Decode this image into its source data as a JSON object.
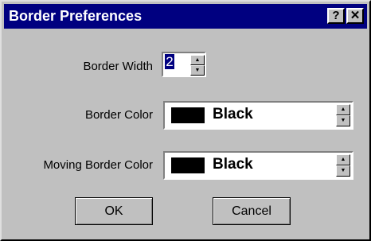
{
  "window": {
    "title": "Border Preferences",
    "help_label": "?",
    "close_label": "✕"
  },
  "fields": {
    "border_width": {
      "label": "Border Width",
      "value": "2"
    },
    "border_color": {
      "label": "Border Color",
      "value": "Black",
      "swatch_color": "#000000"
    },
    "moving_border_color": {
      "label": "Moving Border Color",
      "value": "Black",
      "swatch_color": "#000000"
    }
  },
  "buttons": {
    "ok": "OK",
    "cancel": "Cancel"
  },
  "spin": {
    "up_icon": "▲",
    "down_icon": "▼"
  }
}
